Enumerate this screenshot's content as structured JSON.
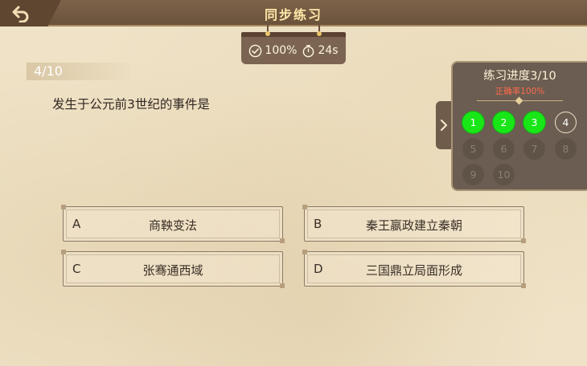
{
  "header": {
    "title": "同步练习",
    "back_icon": "back-arrow-icon"
  },
  "stats": {
    "accuracy": "100%",
    "time": "24s",
    "accuracy_icon": "check-circle-icon",
    "time_icon": "stopwatch-icon"
  },
  "question": {
    "number": "4/10",
    "text": "发生于公元前3世纪的事件是"
  },
  "options": [
    {
      "letter": "A",
      "label": "商鞅变法"
    },
    {
      "letter": "B",
      "label": "秦王嬴政建立秦朝"
    },
    {
      "letter": "C",
      "label": "张骞通西域"
    },
    {
      "letter": "D",
      "label": "三国鼎立局面形成"
    }
  ],
  "progress_panel": {
    "title": "练习进度3/10",
    "accuracy_text": "正确率100%",
    "toggle_icon": "chevron-right-icon",
    "colors": {
      "done": "#18e617",
      "accuracy": "#ff6a4d"
    },
    "questions": [
      {
        "n": "1",
        "state": "done"
      },
      {
        "n": "2",
        "state": "done"
      },
      {
        "n": "3",
        "state": "done"
      },
      {
        "n": "4",
        "state": "current"
      },
      {
        "n": "5",
        "state": "todo"
      },
      {
        "n": "6",
        "state": "todo"
      },
      {
        "n": "7",
        "state": "todo"
      },
      {
        "n": "8",
        "state": "todo"
      },
      {
        "n": "9",
        "state": "todo"
      },
      {
        "n": "10",
        "state": "todo"
      }
    ]
  }
}
